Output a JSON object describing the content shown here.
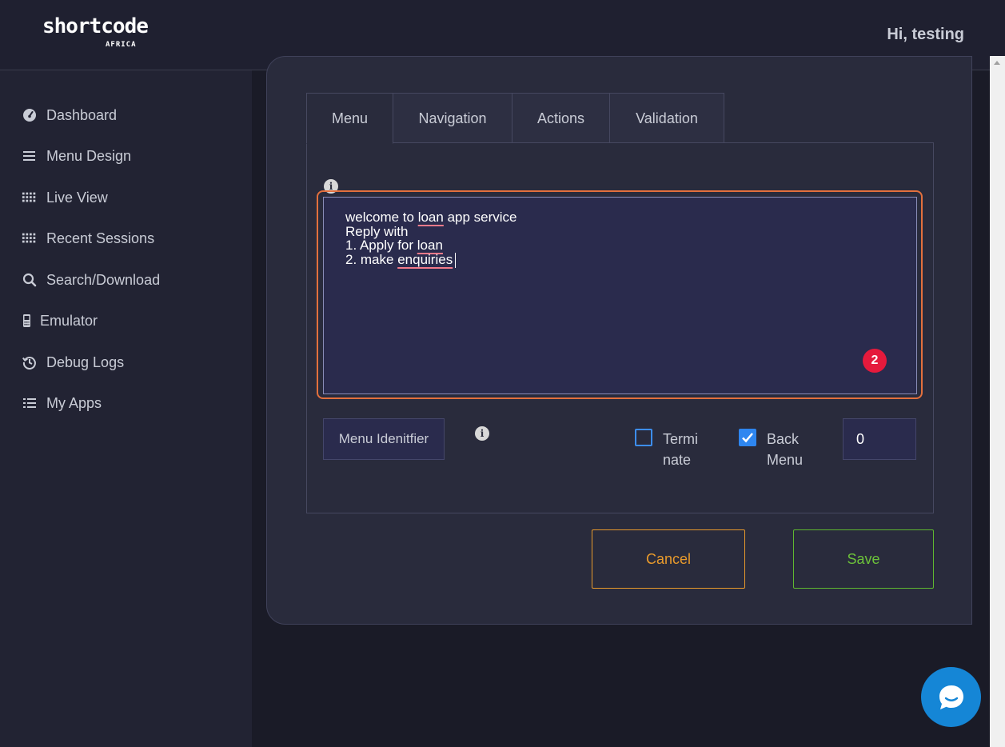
{
  "header": {
    "logo_main": "shortcode",
    "logo_sub": "AFRICA",
    "greeting": "Hi, testing"
  },
  "sidebar": {
    "items": [
      {
        "label": "Dashboard",
        "icon": "dashboard-gauge-icon"
      },
      {
        "label": "Menu Design",
        "icon": "hamburger-menu-icon"
      },
      {
        "label": "Live View",
        "icon": "grid-dots-icon"
      },
      {
        "label": "Recent Sessions",
        "icon": "grid-dots-icon"
      },
      {
        "label": "Search/Download",
        "icon": "search-icon"
      },
      {
        "label": "Emulator",
        "icon": "mobile-phone-icon"
      },
      {
        "label": "Debug Logs",
        "icon": "history-icon"
      },
      {
        "label": "My Apps",
        "icon": "list-icon"
      }
    ]
  },
  "tabs": [
    {
      "label": "Menu",
      "active": true
    },
    {
      "label": "Navigation",
      "active": false
    },
    {
      "label": "Actions",
      "active": false
    },
    {
      "label": "Validation",
      "active": false
    }
  ],
  "menu_text": {
    "lines": [
      [
        "welcome to ",
        "loan",
        " app service"
      ],
      [
        "Reply with"
      ],
      [
        "1. Apply for ",
        "loan"
      ],
      [
        "2. make ",
        "enquiries"
      ]
    ]
  },
  "badge": "2",
  "menu_identifier": {
    "placeholder": "Menu Idenitfier"
  },
  "terminate": {
    "label_line1": "Termi",
    "label_line2": "nate",
    "checked": false
  },
  "back_menu": {
    "label_line1": "Back",
    "label_line2": "Menu",
    "checked": true
  },
  "number_field": {
    "value": "0"
  },
  "buttons": {
    "cancel": "Cancel",
    "save": "Save"
  },
  "colors": {
    "accent_orange": "#e3703d",
    "cancel": "#e89a2c",
    "save": "#6cc23a",
    "checkbox": "#2e86f0",
    "badge": "#e51a3c",
    "chat": "#1586d6"
  }
}
